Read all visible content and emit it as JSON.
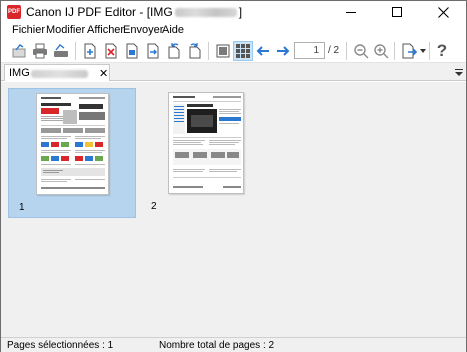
{
  "window": {
    "title_prefix": "Canon IJ PDF Editor - [IMG",
    "title_suffix": "]",
    "app_icon_text": "PDF"
  },
  "menu": [
    "Fichier",
    "Modifier",
    "Afficher",
    "Envoyer",
    "Aide"
  ],
  "toolbar": {
    "page_number": "1",
    "page_total": "/ 2",
    "help_label": "?"
  },
  "tab": {
    "label": "IMG",
    "close": "✕"
  },
  "thumbnails": [
    {
      "number": "1",
      "selected": true
    },
    {
      "number": "2",
      "selected": false
    }
  ],
  "status": {
    "selected_pages": "Pages sélectionnées : 1",
    "total_pages": "Nombre total de pages : 2"
  },
  "colors": {
    "accent": "#2a78d2",
    "selection": "#b7d4ee",
    "app_icon": "#d8262b"
  }
}
